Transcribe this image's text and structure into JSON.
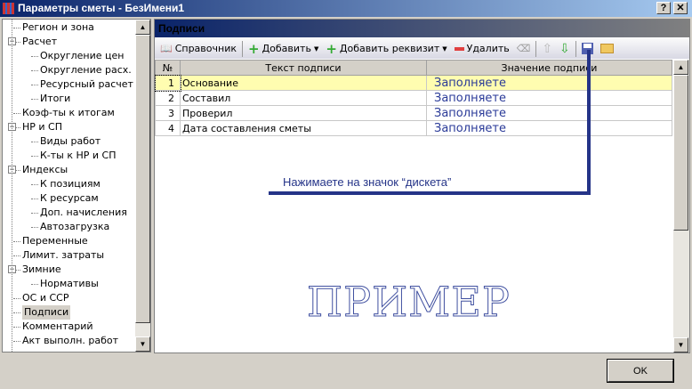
{
  "window": {
    "title": "Параметры сметы - БезИмени1",
    "help": "?",
    "close": "✕"
  },
  "tree": [
    {
      "label": "Регион и зона",
      "level": 0
    },
    {
      "label": "Расчет",
      "level": 0,
      "expander": "−"
    },
    {
      "label": "Округление цен",
      "level": 1
    },
    {
      "label": "Округление расх.",
      "level": 1
    },
    {
      "label": "Ресурсный расчет",
      "level": 1
    },
    {
      "label": "Итоги",
      "level": 1
    },
    {
      "label": "Коэф-ты к итогам",
      "level": 0
    },
    {
      "label": "НР и СП",
      "level": 0,
      "expander": "−"
    },
    {
      "label": "Виды работ",
      "level": 1
    },
    {
      "label": "К-ты к НР и СП",
      "level": 1
    },
    {
      "label": "Индексы",
      "level": 0,
      "expander": "−"
    },
    {
      "label": "К позициям",
      "level": 1
    },
    {
      "label": "К ресурсам",
      "level": 1
    },
    {
      "label": "Доп. начисления",
      "level": 1
    },
    {
      "label": "Автозагрузка",
      "level": 1
    },
    {
      "label": "Переменные",
      "level": 0
    },
    {
      "label": "Лимит. затраты",
      "level": 0
    },
    {
      "label": "Зимние",
      "level": 0,
      "expander": "−"
    },
    {
      "label": "Нормативы",
      "level": 1
    },
    {
      "label": "ОС и ССР",
      "level": 0
    },
    {
      "label": "Подписи",
      "level": 0,
      "selected": true
    },
    {
      "label": "Комментарий",
      "level": 0
    },
    {
      "label": "Акт выполн. работ",
      "level": 0
    }
  ],
  "panel": {
    "title": "Подписи"
  },
  "toolbar": {
    "reference": "Справочник",
    "add": "Добавить",
    "add_attr": "Добавить реквизит",
    "delete": "Удалить"
  },
  "grid": {
    "headers": [
      "№",
      "Текст подписи",
      "Значение подписи"
    ],
    "rows": [
      [
        "1",
        "Основание",
        "Заполняете"
      ],
      [
        "2",
        "Составил",
        "Заполняете"
      ],
      [
        "3",
        "Проверил",
        "Заполняете"
      ],
      [
        "4",
        "Дата составления сметы",
        "Заполняете"
      ]
    ]
  },
  "annotation": "Нажимаете на значок “дискета”",
  "watermark": "ПРИМЕР",
  "ok": "OK"
}
